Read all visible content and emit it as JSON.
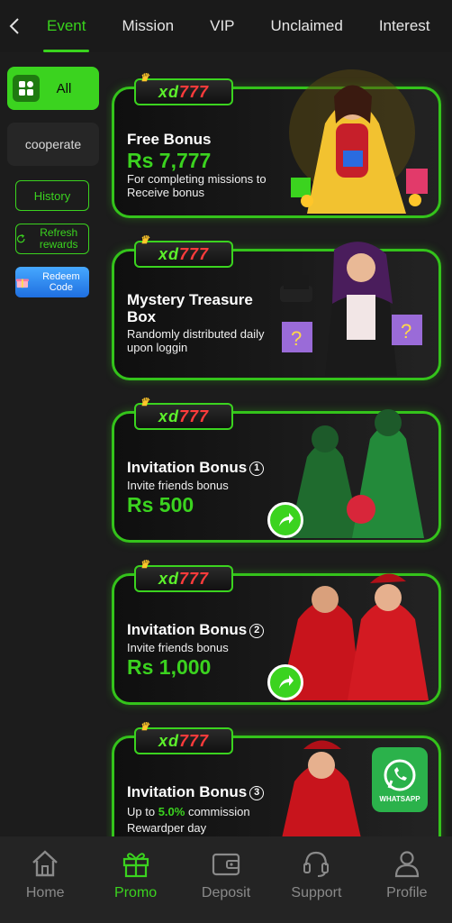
{
  "tabs": [
    "Event",
    "Mission",
    "VIP",
    "Unclaimed",
    "Interest"
  ],
  "active_tab": "Event",
  "sidebar": {
    "all_label": "All",
    "cooperate_label": "cooperate",
    "history_label": "History",
    "refresh_label": "Refresh rewards",
    "redeem_label": "Redeem Code"
  },
  "cards": [
    {
      "logo": "xd777",
      "title": "Free Bonus",
      "amount": "Rs 7,777",
      "subtitle": "For completing missions to Receive bonus"
    },
    {
      "logo": "xd777",
      "title": "Mystery Treasure Box",
      "subtitle": "Randomly distributed daily upon loggin"
    },
    {
      "logo": "xd777",
      "title": "Invitation Bonus",
      "badge": "1",
      "subtitle": "Invite friends bonus",
      "amount": "Rs 500"
    },
    {
      "logo": "xd777",
      "title": "Invitation Bonus",
      "badge": "2",
      "subtitle": "Invite friends bonus",
      "amount": "Rs 1,000"
    },
    {
      "logo": "xd777",
      "title": "Invitation Bonus",
      "badge": "3",
      "subtitle_prefix": "Up to ",
      "subtitle_highlight": "5.0%",
      "subtitle_suffix": " commission",
      "subtitle2": "Rewardper day",
      "whatsapp_label": "WHATSAPP"
    }
  ],
  "bottom_nav": [
    {
      "label": "Home",
      "icon": "home-icon"
    },
    {
      "label": "Promo",
      "icon": "gift-icon",
      "active": true
    },
    {
      "label": "Deposit",
      "icon": "wallet-icon"
    },
    {
      "label": "Support",
      "icon": "headset-icon"
    },
    {
      "label": "Profile",
      "icon": "user-icon"
    }
  ],
  "colors": {
    "accent": "#3bd31f",
    "background": "#1c1c1c",
    "card_border": "#34c31b",
    "amount": "#3bd31f"
  }
}
